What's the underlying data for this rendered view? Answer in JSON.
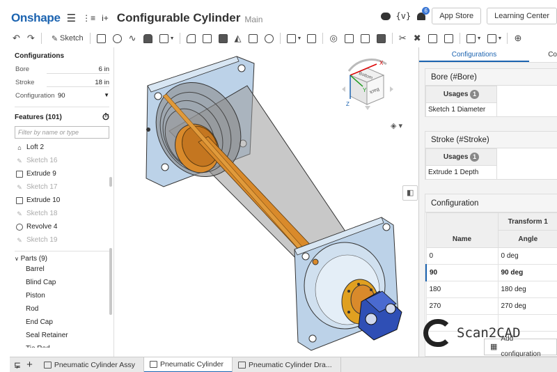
{
  "header": {
    "logo": "Onshape",
    "title": "Configurable Cylinder",
    "branch": "Main",
    "vars_label": "{v}",
    "notification_count": "6",
    "app_store": "App Store",
    "learning_center": "Learning Center"
  },
  "toolbar": {
    "sketch_label": "Sketch"
  },
  "left": {
    "configurations_title": "Configurations",
    "config_rows": [
      {
        "label": "Bore",
        "value": "6 in"
      },
      {
        "label": "Stroke",
        "value": "18 in"
      }
    ],
    "config_select": {
      "label": "Configuration",
      "value": "90"
    },
    "features_title": "Features (101)",
    "filter_placeholder": "Filter by name or type",
    "features": [
      {
        "name": "Loft 2",
        "icon": "loft-icon",
        "suppressed": false
      },
      {
        "name": "Sketch 16",
        "icon": "sketch-icon",
        "suppressed": true
      },
      {
        "name": "Extrude 9",
        "icon": "extrude-icon",
        "suppressed": false
      },
      {
        "name": "Sketch 17",
        "icon": "sketch-icon",
        "suppressed": true
      },
      {
        "name": "Extrude 10",
        "icon": "extrude-icon",
        "suppressed": false
      },
      {
        "name": "Sketch 18",
        "icon": "sketch-icon",
        "suppressed": true
      },
      {
        "name": "Revolve 4",
        "icon": "revolve-icon",
        "suppressed": false
      },
      {
        "name": "Sketch 19",
        "icon": "sketch-icon",
        "suppressed": true
      }
    ],
    "parts_title": "Parts (9)",
    "parts": [
      "Barrel",
      "Blind Cap",
      "Piston",
      "Rod",
      "End Cap",
      "Seal Retainer",
      "Tie Rod"
    ]
  },
  "viewcube": {
    "top_face": "Bottom",
    "front_face": "Back",
    "axis_x": "X",
    "axis_y": "Y",
    "axis_z": "Z"
  },
  "right": {
    "tabs": [
      "Configurations",
      "Co"
    ],
    "bore_card": {
      "title": "Bore (#Bore)",
      "usages_label": "Usages",
      "usages_count": "1",
      "usage": "Sketch 1 Diameter"
    },
    "stroke_card": {
      "title": "Stroke (#Stroke)",
      "usages_label": "Usages",
      "usages_count": "1",
      "usage": "Extrude 1 Depth"
    },
    "config_card": {
      "title": "Configuration",
      "group_header": "Transform 1",
      "col_name": "Name",
      "col_angle": "Angle",
      "rows": [
        {
          "name": "0",
          "angle": "0 deg"
        },
        {
          "name": "90",
          "angle": "90 deg"
        },
        {
          "name": "180",
          "angle": "180 deg"
        },
        {
          "name": "270",
          "angle": "270 deg"
        }
      ],
      "selected": "90"
    },
    "add_configuration": "Add configuration"
  },
  "watermark": "Scan2CAD",
  "bottom_tabs": [
    {
      "label": "Pneumatic Cylinder Assy",
      "active": false
    },
    {
      "label": "Pneumatic Cylinder",
      "active": true
    },
    {
      "label": "Pneumatic Cylinder Dra...",
      "active": false
    }
  ],
  "colors": {
    "accent": "#1b63b0",
    "steel": "#bcd2e8",
    "copper": "#d98a2b",
    "blue_part": "#2f4fb5"
  }
}
